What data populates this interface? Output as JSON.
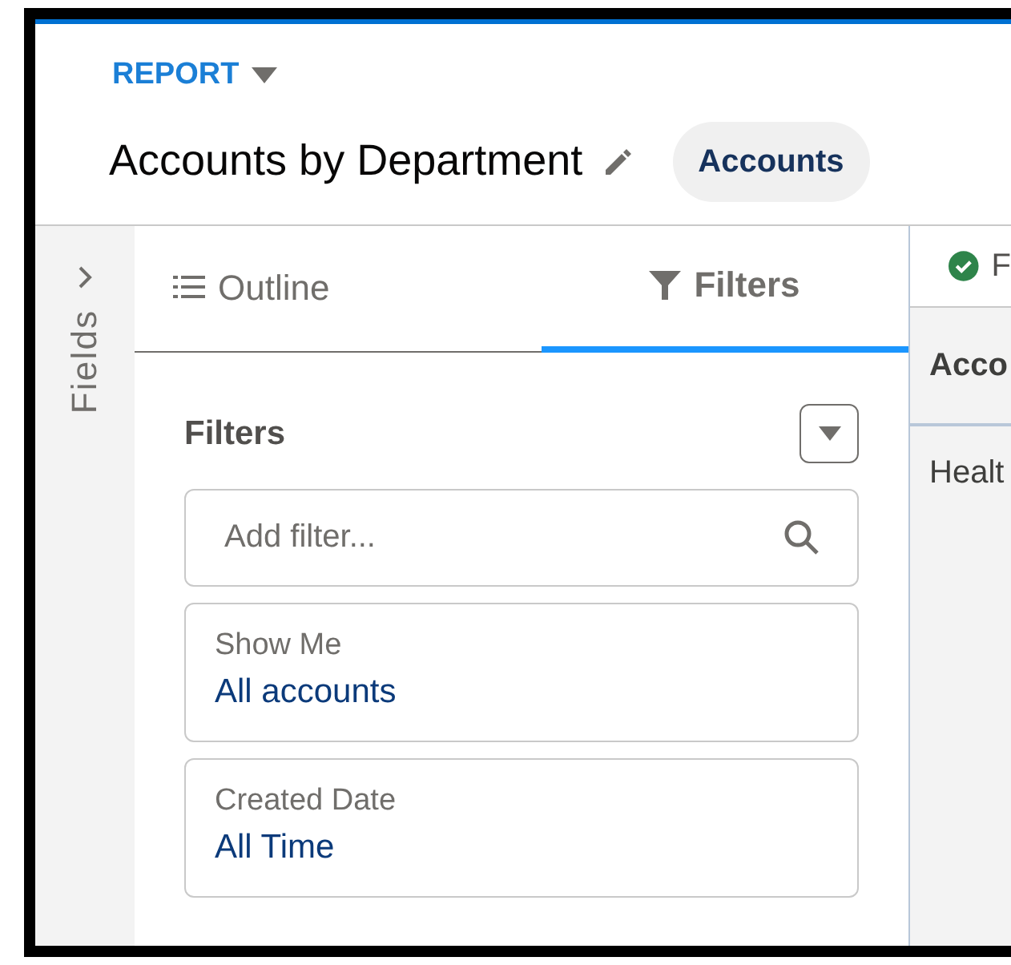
{
  "header": {
    "type_label": "REPORT",
    "title": "Accounts by Department",
    "report_type": "Accounts"
  },
  "fields_rail": {
    "label": "Fields",
    "expanded": false
  },
  "tabs": [
    {
      "label": "Outline",
      "kind": "outline",
      "selected": false
    },
    {
      "label": "Filters",
      "kind": "filter",
      "selected": true
    }
  ],
  "filters": {
    "heading": "Filters",
    "search": {
      "placeholder": "Add filter..."
    },
    "items": [
      {
        "label": "Show Me",
        "value": "All accounts"
      },
      {
        "label": "Created Date",
        "value": "All Time"
      }
    ]
  },
  "preview": {
    "status": "F",
    "column_1": "Acco",
    "rows": [
      "Healt"
    ]
  }
}
